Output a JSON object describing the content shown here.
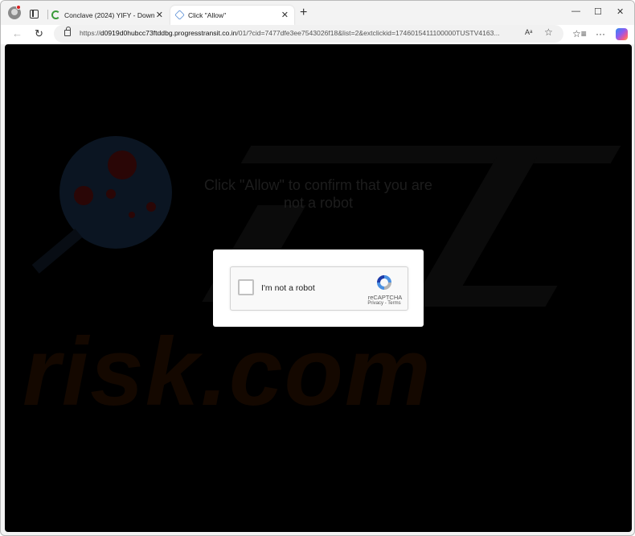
{
  "tabs": [
    {
      "title": "Conclave (2024) YIFY - Download",
      "close": "✕"
    },
    {
      "title": "Click \"Allow\"",
      "close": "✕"
    }
  ],
  "new_tab": "+",
  "window_controls": {
    "minimize": "—",
    "maximize": "☐",
    "close": "✕"
  },
  "toolbar": {
    "back": "←",
    "reload": "↻",
    "url_scheme": "https://",
    "url_host": "d0919d0hubcc73ftddbg.progresstransit.co.in",
    "url_rest": "/01/?cid=7477dfe3ee7543026f18&list=2&extclickid=1746015411100000TUSTV4163...",
    "read_aloud": "Aᵃ",
    "favorites": "☆",
    "collections": "☆≡",
    "more": "···"
  },
  "page": {
    "prompt": "Click \"Allow\" to confirm that you are not a robot",
    "watermark": "risk.com"
  },
  "captcha": {
    "label": "I'm not a robot",
    "brand": "reCAPTCHA",
    "links": "Privacy - Terms"
  }
}
